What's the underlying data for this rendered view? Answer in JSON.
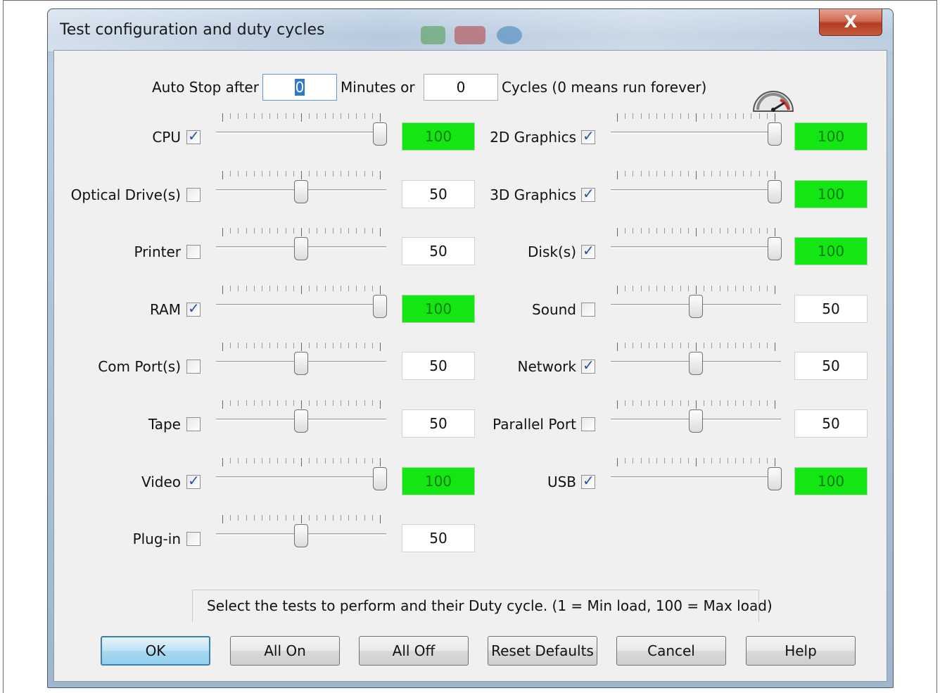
{
  "window": {
    "title": "Test configuration and duty cycles",
    "close_label": "X"
  },
  "auto_stop": {
    "label_prefix": "Auto Stop after",
    "minutes_value": "0",
    "label_middle": "Minutes or",
    "cycles_value": "0",
    "label_suffix": "Cycles (0 means run forever)"
  },
  "tests_left": [
    {
      "label": "CPU",
      "checked": true,
      "value": "100",
      "level": 1.0
    },
    {
      "label": "Optical Drive(s)",
      "checked": false,
      "value": "50",
      "level": 0.5
    },
    {
      "label": "Printer",
      "checked": false,
      "value": "50",
      "level": 0.5
    },
    {
      "label": "RAM",
      "checked": true,
      "value": "100",
      "level": 1.0
    },
    {
      "label": "Com Port(s)",
      "checked": false,
      "value": "50",
      "level": 0.5
    },
    {
      "label": "Tape",
      "checked": false,
      "value": "50",
      "level": 0.5
    },
    {
      "label": "Video",
      "checked": true,
      "value": "100",
      "level": 1.0
    },
    {
      "label": "Plug-in",
      "checked": false,
      "value": "50",
      "level": 0.5
    }
  ],
  "tests_right": [
    {
      "label": "2D Graphics",
      "checked": true,
      "value": "100",
      "level": 1.0
    },
    {
      "label": "3D Graphics",
      "checked": true,
      "value": "100",
      "level": 1.0
    },
    {
      "label": "Disk(s)",
      "checked": true,
      "value": "100",
      "level": 1.0
    },
    {
      "label": "Sound",
      "checked": false,
      "value": "50",
      "level": 0.5
    },
    {
      "label": "Network",
      "checked": true,
      "value": "50",
      "level": 0.5
    },
    {
      "label": "Parallel Port",
      "checked": false,
      "value": "50",
      "level": 0.5
    },
    {
      "label": "USB",
      "checked": true,
      "value": "100",
      "level": 1.0
    }
  ],
  "status_text": "Select the tests to perform and their Duty cycle. (1 = Min load, 100 = Max load)",
  "buttons": {
    "ok": "OK",
    "all_on": "All On",
    "all_off": "All Off",
    "reset": "Reset Defaults",
    "cancel": "Cancel",
    "help": "Help"
  },
  "colors": {
    "active_value_bg": "#14e614",
    "check_mark": "#2b4fa2",
    "default_button": "#3c7fb1"
  },
  "icons": {
    "check": "✓",
    "gauge": "speedometer-icon"
  }
}
